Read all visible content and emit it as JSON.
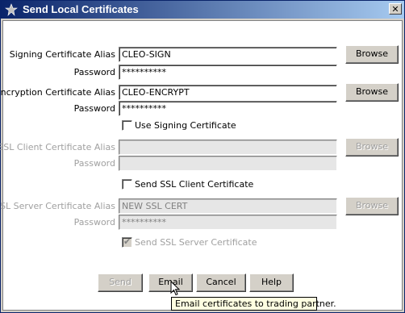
{
  "window": {
    "title": "Send Local Certificates",
    "close_label": "✕"
  },
  "signing": {
    "alias_label": "Signing Certificate Alias",
    "alias_value": "CLEO-SIGN",
    "password_label": "Password",
    "password_value": "**********",
    "browse_label": "Browse"
  },
  "encryption": {
    "alias_label": "Encryption Certificate Alias",
    "alias_value": "CLEO-ENCRYPT",
    "password_label": "Password",
    "password_value": "**********",
    "browse_label": "Browse",
    "use_signing_label": "Use Signing Certificate"
  },
  "ssl_client": {
    "alias_label": "SSL Client Certificate Alias",
    "alias_value": "",
    "password_label": "Password",
    "password_value": "",
    "browse_label": "Browse",
    "send_label": "Send SSL Client Certificate"
  },
  "ssl_server": {
    "alias_label": "SSL Server Certificate Alias",
    "alias_value": "NEW SSL CERT",
    "password_label": "Password",
    "password_value": "**********",
    "browse_label": "Browse",
    "send_label": "Send SSL Server Certificate",
    "send_checked": true
  },
  "buttons": {
    "send": "Send",
    "email": "Email",
    "cancel": "Cancel",
    "help": "Help"
  },
  "tooltip": "Email certificates to trading partner.",
  "icons": {
    "title": "app-icon",
    "cursor": "arrow-cursor-icon"
  }
}
